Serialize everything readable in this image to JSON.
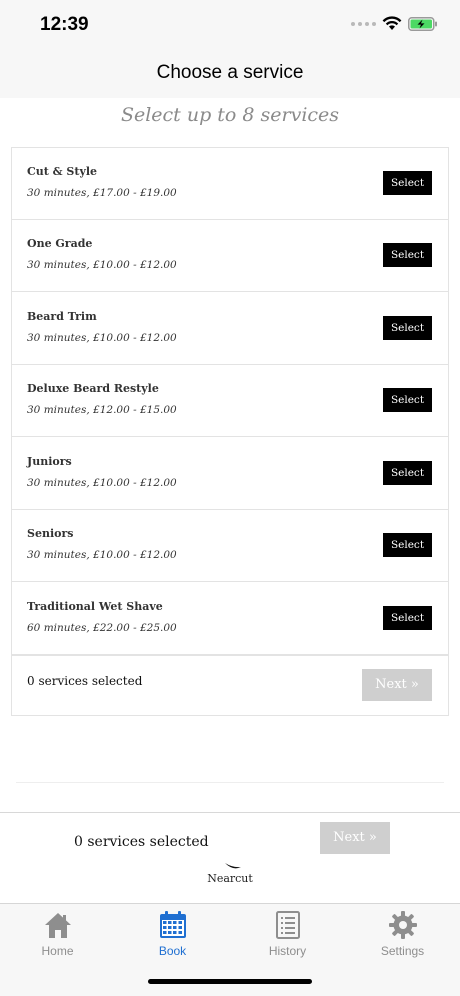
{
  "status": {
    "time": "12:39",
    "icons": [
      "cellular-dots-icon",
      "wifi-icon",
      "battery-charging-icon"
    ],
    "battery_color": "#4cd964"
  },
  "header": {
    "title": "Choose a service"
  },
  "subtitle": "Select up to 8 services",
  "services": [
    {
      "name": "Cut & Style",
      "detail": "30 minutes, £17.00 - £19.00",
      "button": "Select"
    },
    {
      "name": "One Grade",
      "detail": "30 minutes, £10.00 - £12.00",
      "button": "Select"
    },
    {
      "name": "Beard Trim",
      "detail": "30 minutes, £10.00 - £12.00",
      "button": "Select"
    },
    {
      "name": "Deluxe Beard Restyle",
      "detail": "30 minutes, £12.00 - £15.00",
      "button": "Select"
    },
    {
      "name": "Juniors",
      "detail": "30 minutes, £10.00 - £12.00",
      "button": "Select"
    },
    {
      "name": "Seniors",
      "detail": "30 minutes, £10.00 - £12.00",
      "button": "Select"
    },
    {
      "name": "Traditional Wet Shave",
      "detail": "60 minutes, £22.00 - £25.00",
      "button": "Select"
    }
  ],
  "card_footer": {
    "selected_text": "0 services selected",
    "next_label": "Next »"
  },
  "bottom_bar": {
    "selected_text": "0 services selected",
    "next_label": "Next »"
  },
  "brand": {
    "name": "Nearcut"
  },
  "tabs": [
    {
      "label": "Home",
      "icon": "home-icon",
      "active": false
    },
    {
      "label": "Book",
      "icon": "calendar-icon",
      "active": true
    },
    {
      "label": "History",
      "icon": "history-list-icon",
      "active": false
    },
    {
      "label": "Settings",
      "icon": "gear-icon",
      "active": false
    }
  ],
  "colors": {
    "accent": "#1f6fd1",
    "inactive_tab": "#8e8e8e",
    "select_button": "#000000",
    "next_disabled": "#cfcfcf"
  }
}
